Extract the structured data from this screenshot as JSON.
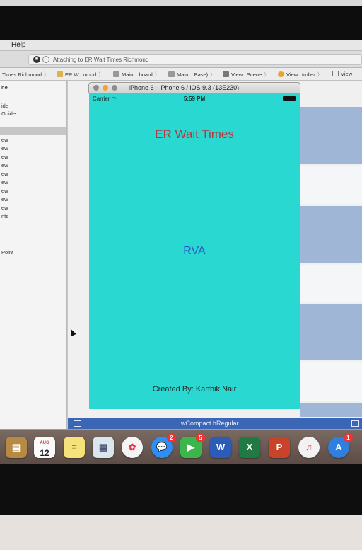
{
  "menubar": {
    "help_label": "Help"
  },
  "toolbar": {
    "activity_text": "Attaching to ER Wait Times Richmond"
  },
  "jumpbar": {
    "crumbs": [
      "Times Richmond",
      "ER W...mond",
      "Main....board",
      "Main....Base)",
      "View...Scene",
      "View...troller",
      "View"
    ]
  },
  "navigator": {
    "items": [
      "ne",
      "ide",
      "Guide",
      "ew",
      "ew",
      "ew",
      "ew",
      "ew",
      "ew",
      "ew",
      "ew",
      "ew",
      "nts",
      "Point"
    ]
  },
  "simulator": {
    "window_title": "iPhone 6 - iPhone 6 / iOS 9.3 (13E230)",
    "carrier": "Carrier",
    "time": "5:59 PM",
    "background_color": "#2ad8d2"
  },
  "app": {
    "title": "ER Wait Times",
    "title_color": "#b2383e",
    "city": "RVA",
    "city_color": "#2e58c8",
    "credit": "Created By: Karthik Nair"
  },
  "sizeclass": {
    "label": "wCompact hRegular"
  },
  "dock": {
    "calendar_month": "AUG",
    "calendar_day": "12",
    "messages_badge": "2",
    "facetime_badge": "5",
    "appstore_badge": "1",
    "word_label": "W",
    "excel_label": "X",
    "powerpoint_label": "P"
  }
}
